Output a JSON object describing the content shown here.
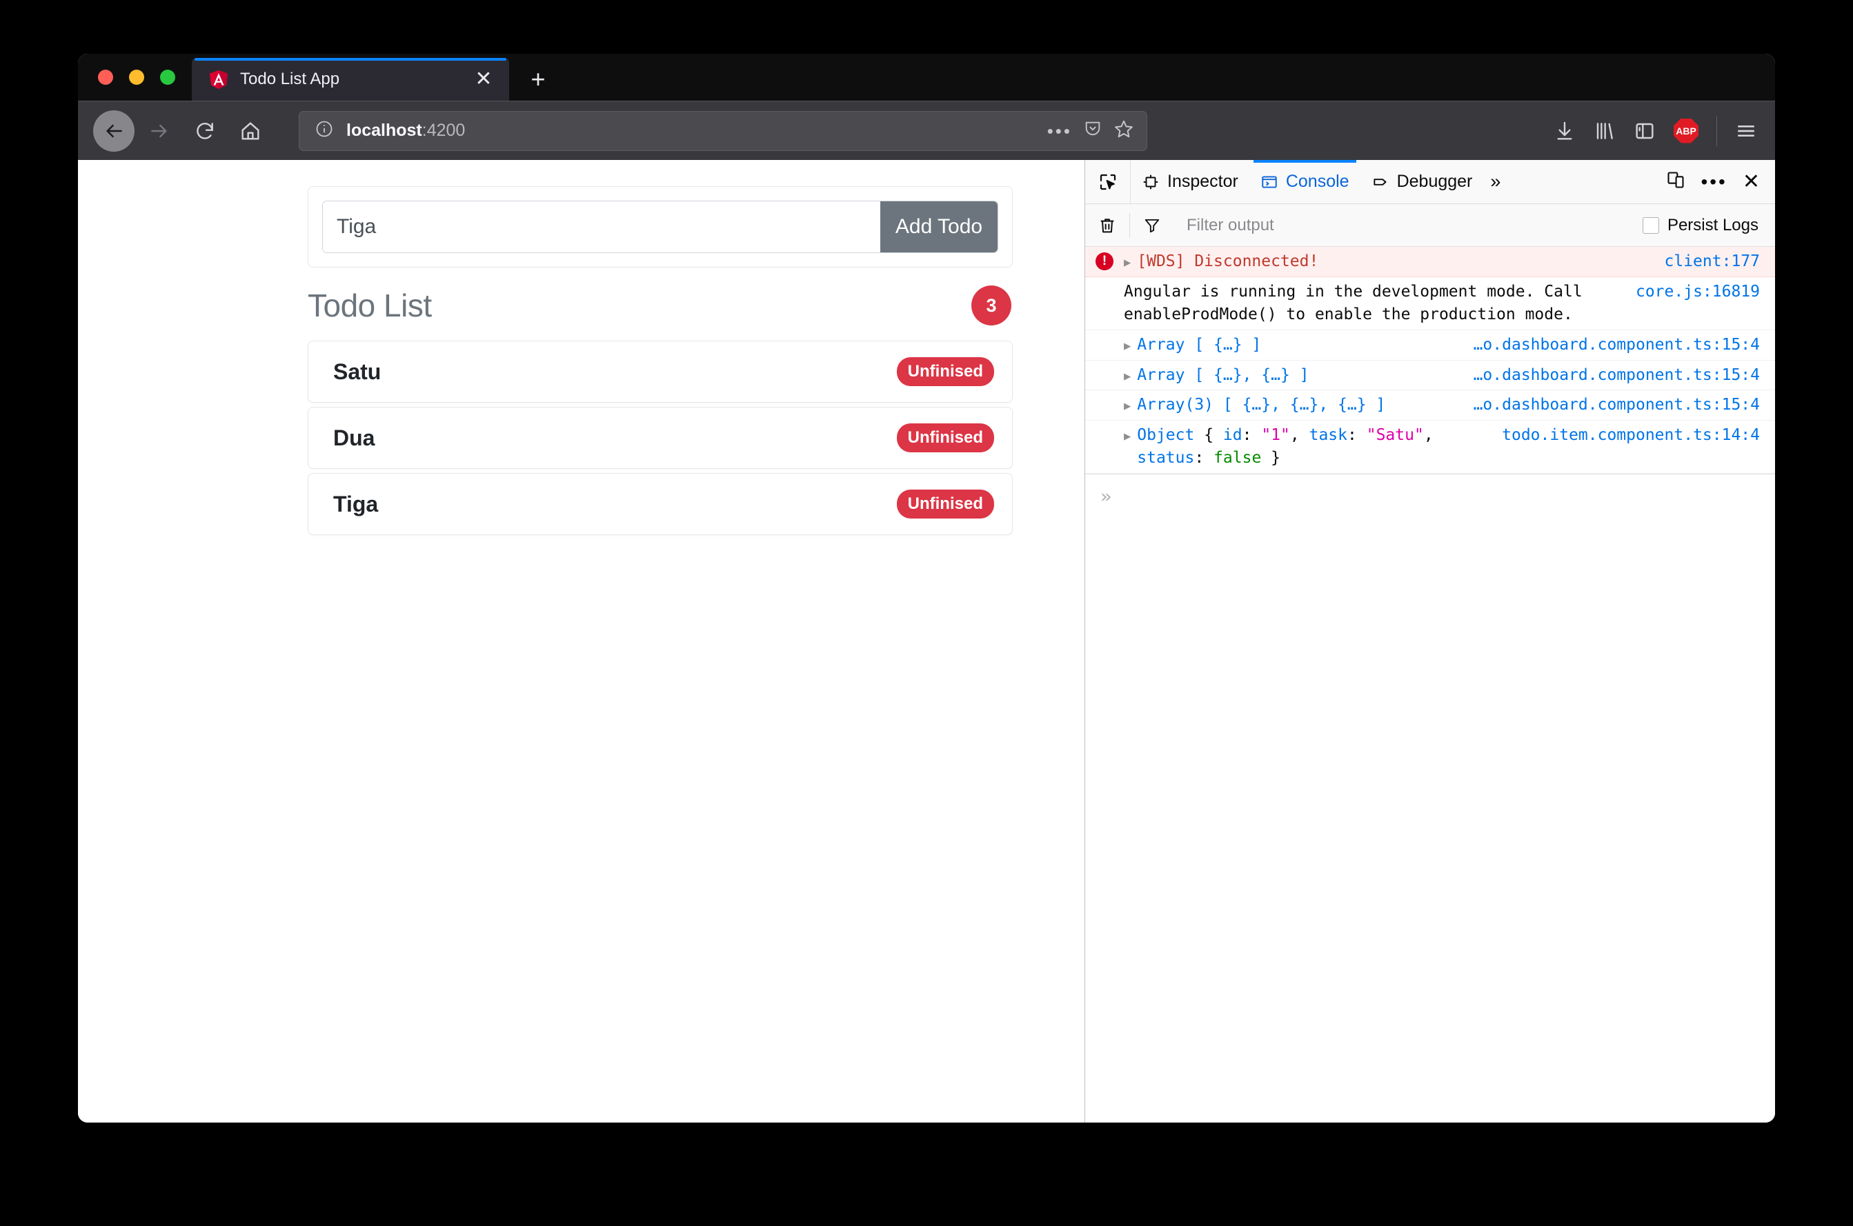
{
  "browser": {
    "tab": {
      "title": "Todo List App",
      "favicon_icon": "angular-logo-icon",
      "close_icon": "close-icon"
    },
    "new_tab_label": "+",
    "nav": {
      "back_icon": "arrow-left-icon",
      "forward_icon": "arrow-right-icon",
      "reload_icon": "reload-icon",
      "home_icon": "home-icon",
      "url_info_icon": "info-circle-icon",
      "url_host": "localhost",
      "url_port": ":4200",
      "page_actions_icon": "ellipsis-icon",
      "pocket_icon": "pocket-shield-icon",
      "bookmark_icon": "star-icon",
      "downloads_icon": "download-icon",
      "library_icon": "library-icon",
      "sidebar_icon": "sidebar-icon",
      "adblock_label": "ABP",
      "menu_icon": "hamburger-menu-icon"
    }
  },
  "app": {
    "input": {
      "value": "Tiga",
      "placeholder": ""
    },
    "add_button_label": "Add Todo",
    "list_title": "Todo List",
    "count_badge": "3",
    "todos": [
      {
        "task": "Satu",
        "status_label": "Unfinised"
      },
      {
        "task": "Dua",
        "status_label": "Unfinised"
      },
      {
        "task": "Tiga",
        "status_label": "Unfinised"
      }
    ]
  },
  "devtools": {
    "picker_icon": "element-picker-icon",
    "tabs": [
      {
        "label": "Inspector",
        "icon": "inspector-icon",
        "active": false
      },
      {
        "label": "Console",
        "icon": "console-icon",
        "active": true
      },
      {
        "label": "Debugger",
        "icon": "debugger-icon",
        "active": false
      }
    ],
    "overflow_label": "»",
    "responsive_icon": "responsive-design-mode-icon",
    "meatball_icon": "ellipsis-icon",
    "close_icon": "close-icon",
    "toolbar": {
      "clear_icon": "trash-icon",
      "filter_icon": "funnel-icon",
      "filter_placeholder": "Filter output",
      "persist_logs_label": "Persist Logs",
      "persist_logs_checked": false
    },
    "messages": [
      {
        "level": "error",
        "expandable": true,
        "text": "[WDS] Disconnected!",
        "source": "client:177"
      },
      {
        "level": "log",
        "expandable": false,
        "text": "Angular is running in the development mode. Call enableProdMode() to enable the production mode.",
        "source": "core.js:16819"
      },
      {
        "level": "log",
        "expandable": true,
        "text": "Array [ {…} ]",
        "source": "…o.dashboard.component.ts:15:4"
      },
      {
        "level": "log",
        "expandable": true,
        "text": "Array [ {…}, {…} ]",
        "source": "…o.dashboard.component.ts:15:4"
      },
      {
        "level": "log",
        "expandable": true,
        "text": "Array(3) [ {…}, {…}, {…} ]",
        "source": "…o.dashboard.component.ts:15:4"
      },
      {
        "level": "log",
        "expandable": true,
        "text": "Object { id: \"1\", task: \"Satu\", status: false }",
        "source": "todo.item.component.ts:14:4"
      }
    ],
    "prompt_symbol": "»"
  },
  "colors": {
    "accent_blue": "#0a84ff",
    "danger_red": "#dc3545",
    "button_gray": "#6c757d",
    "error_text": "#c0392b",
    "link_blue": "#0074e8"
  }
}
